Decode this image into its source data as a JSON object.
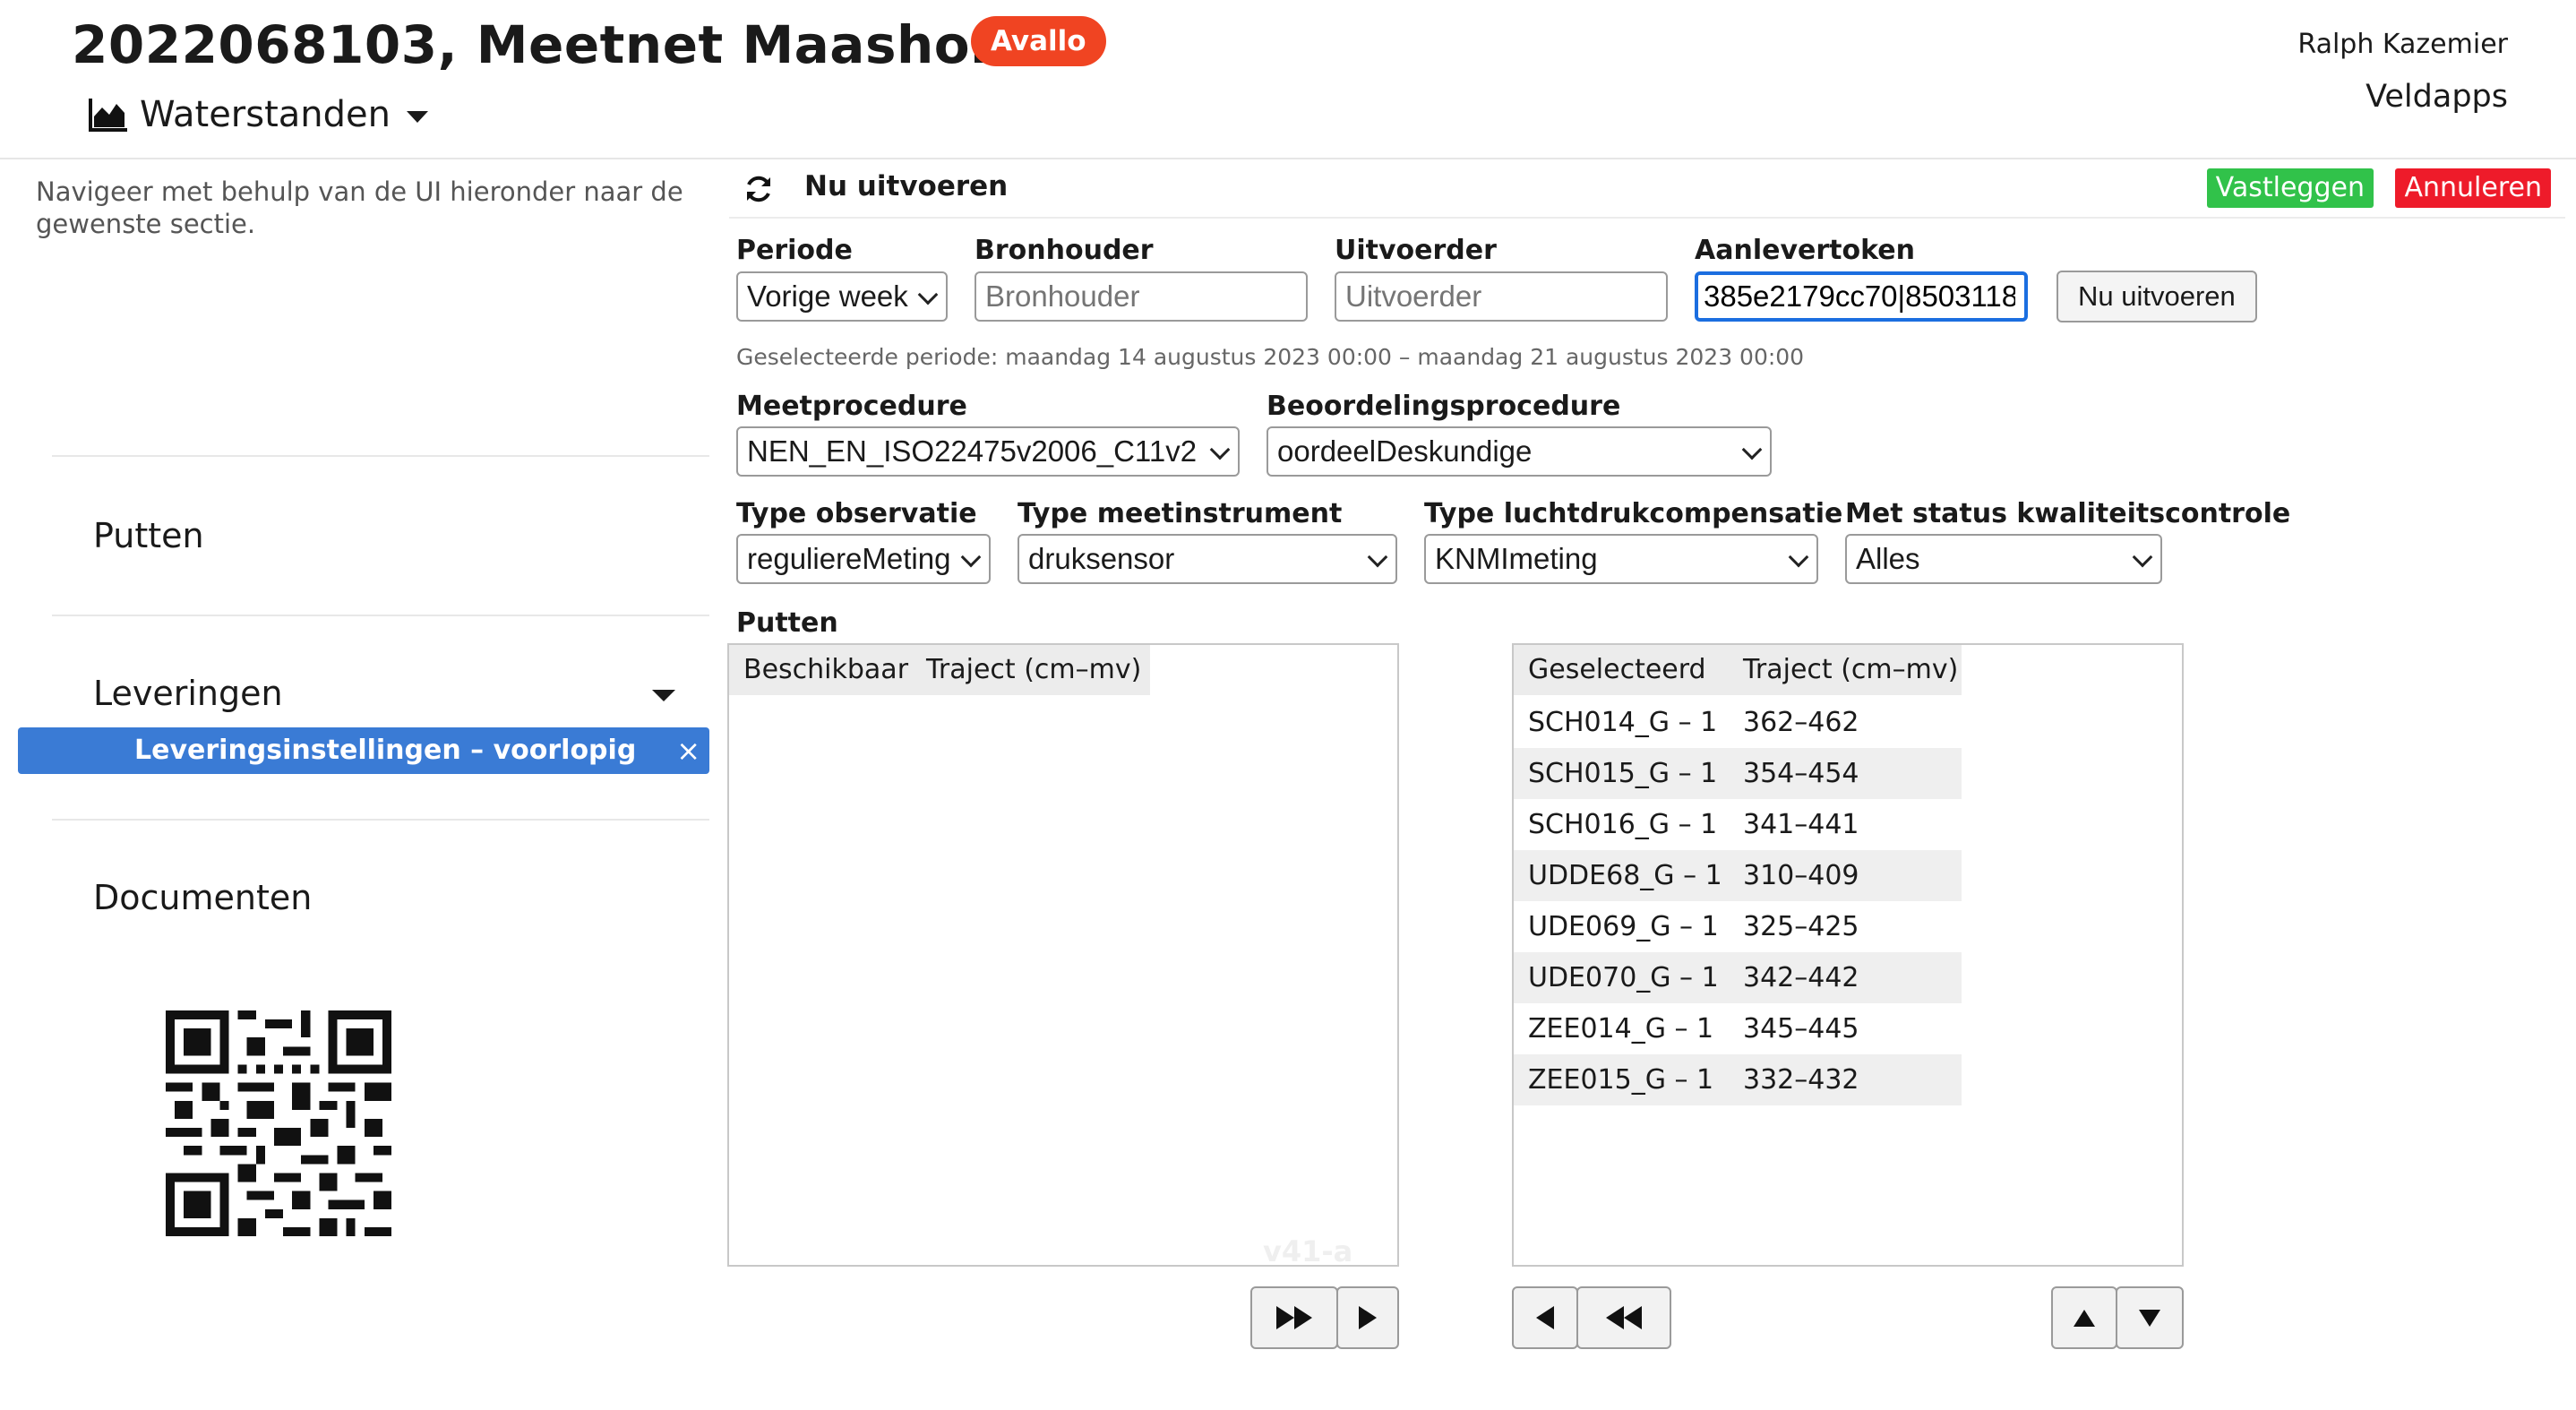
{
  "header": {
    "title": "2022068103, Meetnet Maashorst",
    "badge": "Avallo",
    "view_label": "Waterstanden",
    "user_name": "Ralph Kazemier",
    "apps_label": "Veldapps",
    "badge_color": "#f04422"
  },
  "sidebar": {
    "hint": "Navigeer met behulp van de UI hieronder naar de gewenste sectie.",
    "items": [
      {
        "label": "Putten"
      },
      {
        "label": "Leveringen"
      },
      {
        "label": "Documenten"
      }
    ],
    "active_subitem": "Leveringsinstellingen – voorlopig",
    "close_glyph": "×",
    "active_color": "#3a7bd5"
  },
  "toolbar": {
    "run_label": "Nu uitvoeren",
    "save_label": "Vastleggen",
    "cancel_label": "Annuleren",
    "save_color": "#31c24a",
    "cancel_color": "#ee1b2a"
  },
  "form": {
    "periode": {
      "label": "Periode",
      "value": "Vorige week"
    },
    "bronhouder": {
      "label": "Bronhouder",
      "placeholder": "Bronhouder"
    },
    "uitvoerder": {
      "label": "Uitvoerder",
      "placeholder": "Uitvoerder"
    },
    "aanlevertoken": {
      "label": "Aanlevertoken",
      "value": "385e2179cc70|8503118"
    },
    "run_button": "Nu uitvoeren",
    "period_info": "Geselecteerde periode: maandag 14 augustus 2023 00:00 – maandag 21 augustus 2023 00:00",
    "meetprocedure": {
      "label": "Meetprocedure",
      "value": "NEN_EN_ISO22475v2006_C11v2"
    },
    "beoordelingsprocedure": {
      "label": "Beoordelingsprocedure",
      "value": "oordeelDeskundige"
    },
    "type_observatie": {
      "label": "Type observatie",
      "value": "regulierеMeting"
    },
    "type_meetinstrument": {
      "label": "Type meetinstrument",
      "value": "druksensor"
    },
    "type_luchtdruk": {
      "label": "Type luchtdrukcompensatie",
      "value": "KNMImeting"
    },
    "status_kwaliteit": {
      "label": "Met status kwaliteitscontrole",
      "value": "Alles"
    }
  },
  "putten": {
    "label": "Putten",
    "available": {
      "col1": "Beschikbaar",
      "col2": "Traject (cm–mv)",
      "rows": []
    },
    "selected": {
      "col1": "Geselecteerd",
      "col2": "Traject (cm–mv)",
      "rows": [
        {
          "name": "SCH014_G – 1",
          "traject": "362–462"
        },
        {
          "name": "SCH015_G – 1",
          "traject": "354–454"
        },
        {
          "name": "SCH016_G – 1",
          "traject": "341–441"
        },
        {
          "name": "UDDE68_G – 1",
          "traject": "310–409"
        },
        {
          "name": "UDE069_G – 1",
          "traject": "325–425"
        },
        {
          "name": "UDE070_G – 1",
          "traject": "342–442"
        },
        {
          "name": "ZEE014_G – 1",
          "traject": "345–445"
        },
        {
          "name": "ZEE015_G – 1",
          "traject": "332–432"
        }
      ]
    },
    "watermark": "v41-a"
  }
}
